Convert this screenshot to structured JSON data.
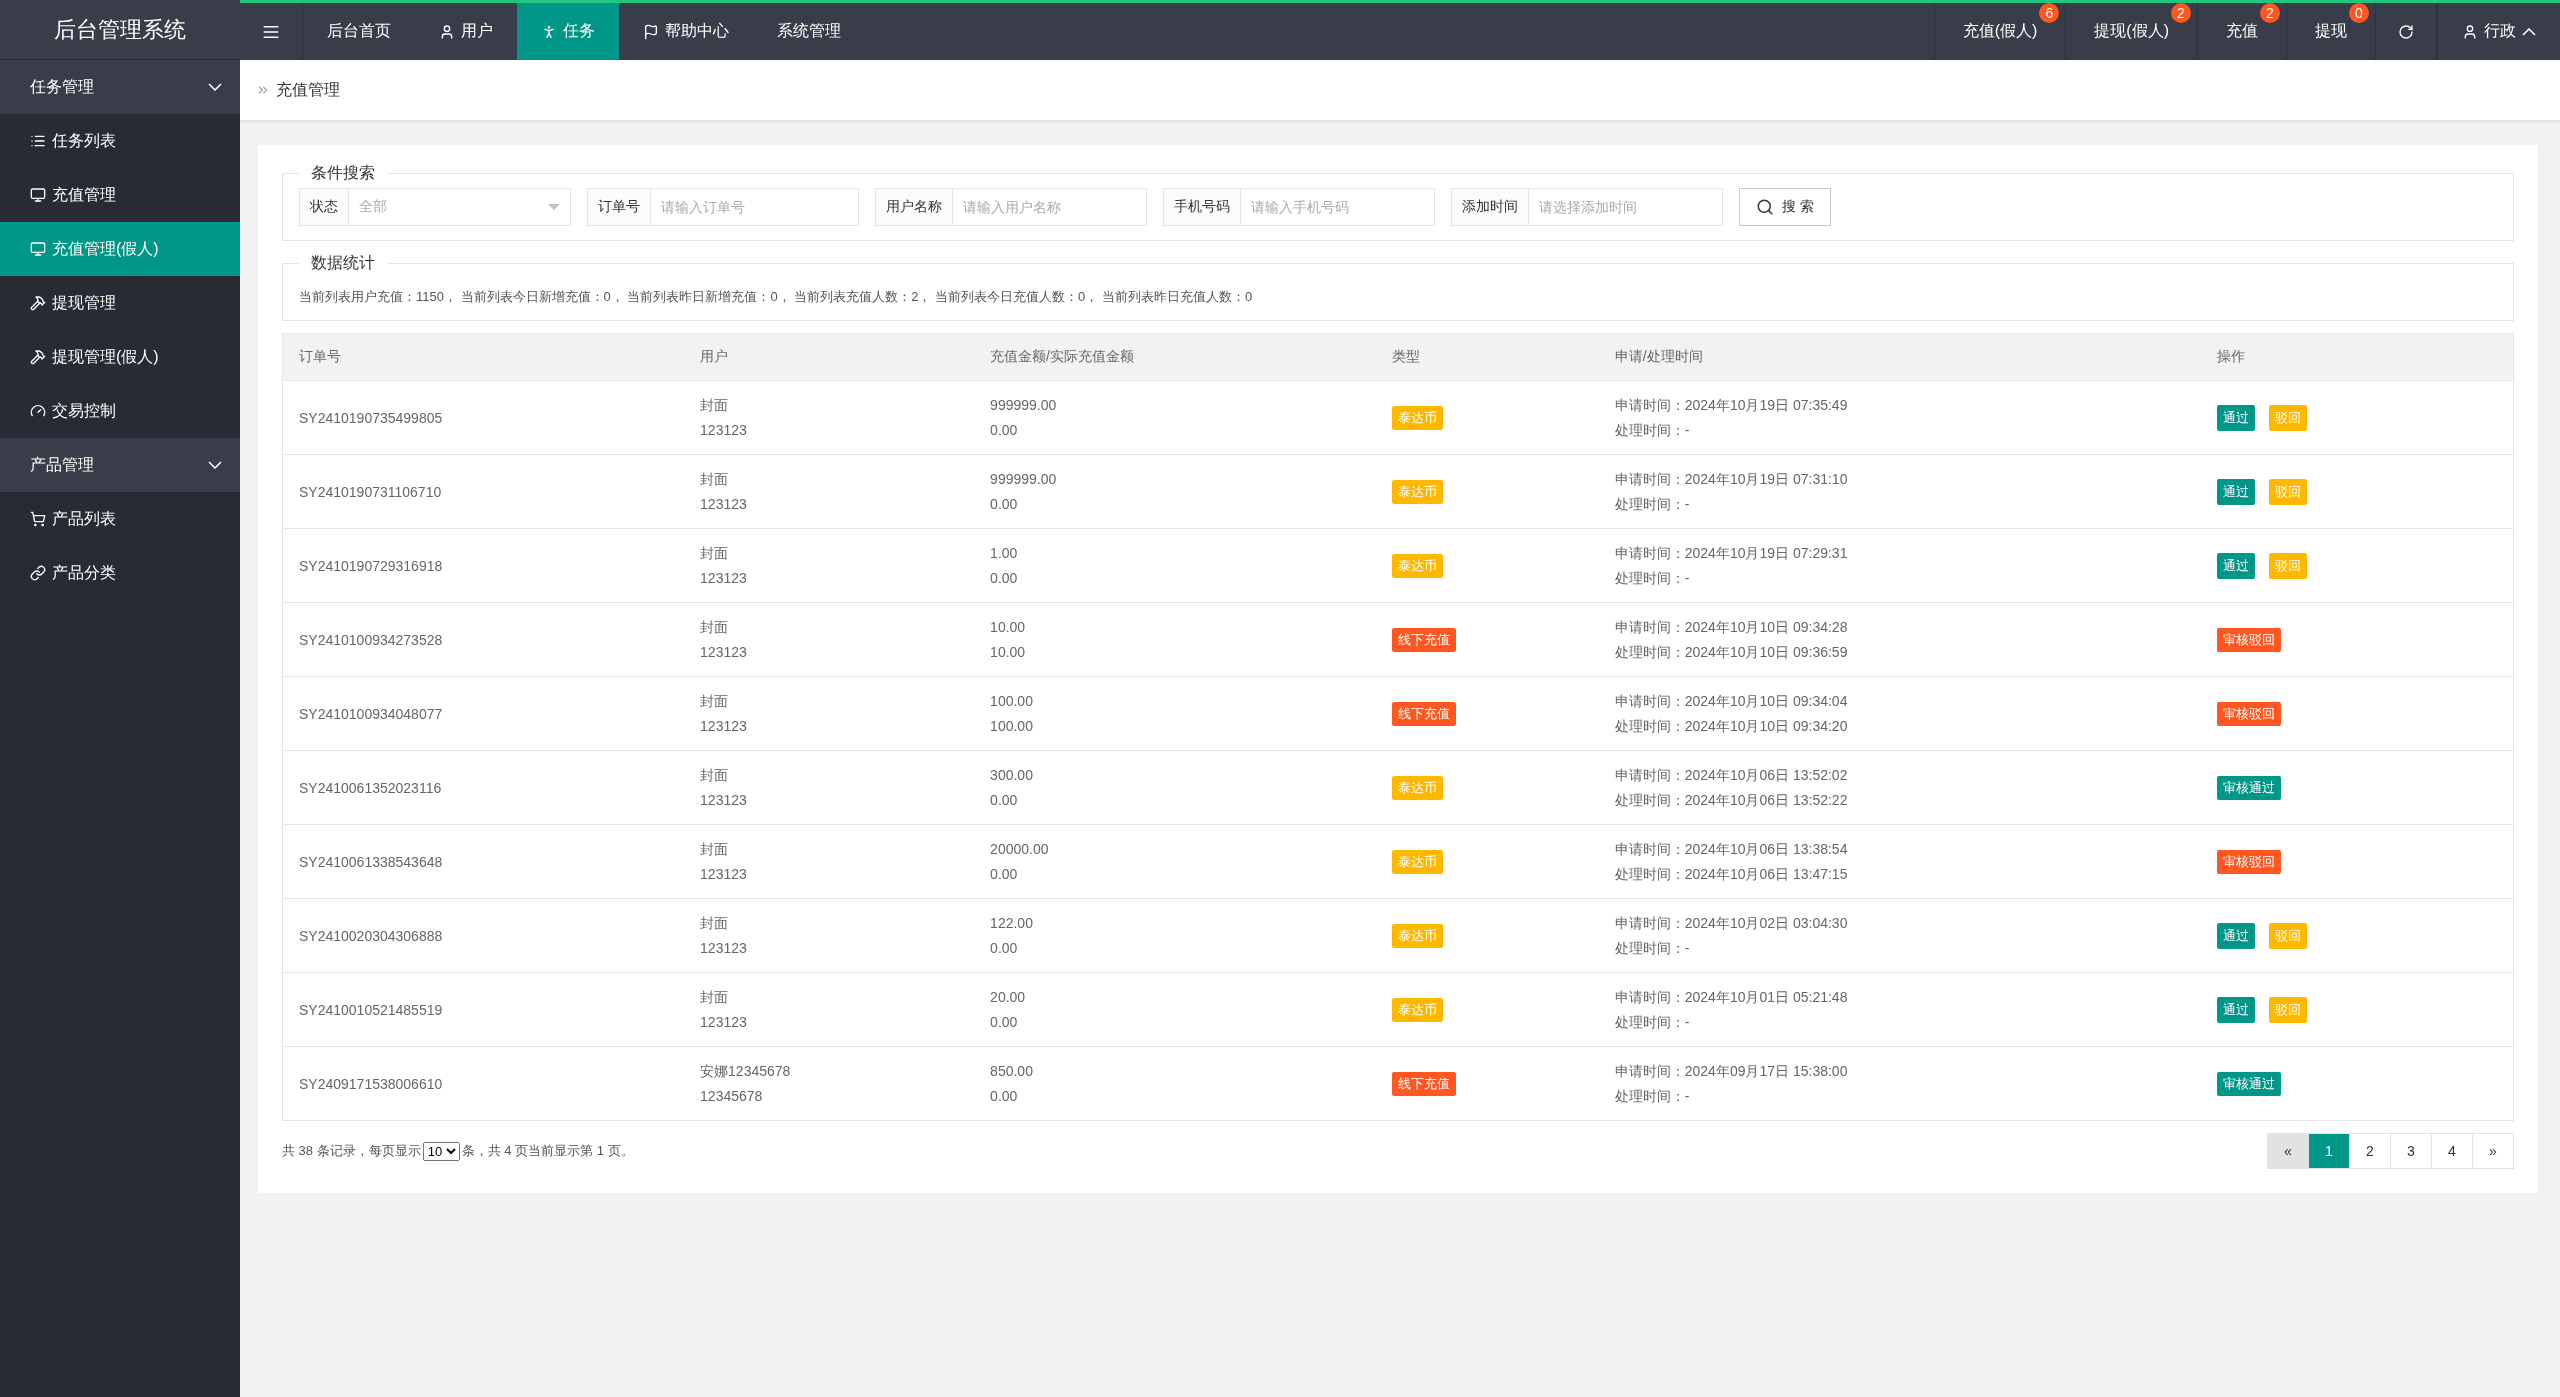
{
  "brand": "后台管理系统",
  "topnav": [
    {
      "label": "后台首页",
      "selected": false
    },
    {
      "label": "用户",
      "selected": false
    },
    {
      "label": "任务",
      "selected": true
    },
    {
      "label": "帮助中心",
      "selected": false
    },
    {
      "label": "系统管理",
      "selected": false
    }
  ],
  "counters": [
    {
      "label": "充值(假人)",
      "count": "6"
    },
    {
      "label": "提现(假人)",
      "count": "2"
    },
    {
      "label": "充值",
      "count": "2"
    },
    {
      "label": "提现",
      "count": "0"
    }
  ],
  "account": {
    "name": "行政",
    "expanded": true
  },
  "sidebar": [
    {
      "label": "任务管理",
      "expanded": true,
      "children": [
        {
          "label": "任务列表",
          "selected": false
        },
        {
          "label": "充值管理",
          "selected": false
        },
        {
          "label": "充值管理(假人)",
          "selected": true
        },
        {
          "label": "提现管理",
          "selected": false
        },
        {
          "label": "提现管理(假人)",
          "selected": false
        },
        {
          "label": "交易控制",
          "selected": false
        }
      ]
    },
    {
      "label": "产品管理",
      "expanded": true,
      "children": [
        {
          "label": "产品列表",
          "selected": false
        },
        {
          "label": "产品分类",
          "selected": false
        }
      ]
    }
  ],
  "breadcrumb": "充值管理",
  "search": {
    "legend": "条件搜索",
    "fields": [
      {
        "kind": "select",
        "label": "状态",
        "value": "全部"
      },
      {
        "kind": "text",
        "label": "订单号",
        "placeholder": "请输入订单号"
      },
      {
        "kind": "text",
        "label": "用户名称",
        "placeholder": "请输入用户名称"
      },
      {
        "kind": "text",
        "label": "手机号码",
        "placeholder": "请输入手机号码"
      },
      {
        "kind": "text",
        "label": "添加时间",
        "placeholder": "请选择添加时间"
      }
    ],
    "button": "搜 索"
  },
  "stats": {
    "legend": "数据统计",
    "text": "当前列表用户充值：1150， 当前列表今日新增充值：0， 当前列表昨日新增充值：0， 当前列表充值人数：2， 当前列表今日充值人数：0， 当前列表昨日充值人数：0"
  },
  "table": {
    "columns": [
      "订单号",
      "用户",
      "充值金额/实际充值金额",
      "类型",
      "申请/处理时间",
      "操作"
    ],
    "rows": [
      {
        "order": "SY2410190735499805",
        "user": [
          "封面",
          "123123"
        ],
        "amount": [
          "999999.00",
          "0.00"
        ],
        "type": {
          "label": "泰达币",
          "kind": "coin"
        },
        "time": [
          "申请时间：2024年10月19日 07:35:49",
          "处理时间：-"
        ],
        "actions": [
          {
            "label": "通过",
            "kind": "approve"
          },
          {
            "label": "驳回",
            "kind": "reject"
          }
        ]
      },
      {
        "order": "SY2410190731106710",
        "user": [
          "封面",
          "123123"
        ],
        "amount": [
          "999999.00",
          "0.00"
        ],
        "type": {
          "label": "泰达币",
          "kind": "coin"
        },
        "time": [
          "申请时间：2024年10月19日 07:31:10",
          "处理时间：-"
        ],
        "actions": [
          {
            "label": "通过",
            "kind": "approve"
          },
          {
            "label": "驳回",
            "kind": "reject"
          }
        ]
      },
      {
        "order": "SY2410190729316918",
        "user": [
          "封面",
          "123123"
        ],
        "amount": [
          "1.00",
          "0.00"
        ],
        "type": {
          "label": "泰达币",
          "kind": "coin"
        },
        "time": [
          "申请时间：2024年10月19日 07:29:31",
          "处理时间：-"
        ],
        "actions": [
          {
            "label": "通过",
            "kind": "approve"
          },
          {
            "label": "驳回",
            "kind": "reject"
          }
        ]
      },
      {
        "order": "SY2410100934273528",
        "user": [
          "封面",
          "123123"
        ],
        "amount": [
          "10.00",
          "10.00"
        ],
        "type": {
          "label": "线下充值",
          "kind": "offline"
        },
        "time": [
          "申请时间：2024年10月10日 09:34:28",
          "处理时间：2024年10月10日 09:36:59"
        ],
        "actions": [
          {
            "label": "审核驳回",
            "kind": "rejected"
          }
        ]
      },
      {
        "order": "SY2410100934048077",
        "user": [
          "封面",
          "123123"
        ],
        "amount": [
          "100.00",
          "100.00"
        ],
        "type": {
          "label": "线下充值",
          "kind": "offline"
        },
        "time": [
          "申请时间：2024年10月10日 09:34:04",
          "处理时间：2024年10月10日 09:34:20"
        ],
        "actions": [
          {
            "label": "审核驳回",
            "kind": "rejected"
          }
        ]
      },
      {
        "order": "SY2410061352023116",
        "user": [
          "封面",
          "123123"
        ],
        "amount": [
          "300.00",
          "0.00"
        ],
        "type": {
          "label": "泰达币",
          "kind": "coin"
        },
        "time": [
          "申请时间：2024年10月06日 13:52:02",
          "处理时间：2024年10月06日 13:52:22"
        ],
        "actions": [
          {
            "label": "审核通过",
            "kind": "approved"
          }
        ]
      },
      {
        "order": "SY2410061338543648",
        "user": [
          "封面",
          "123123"
        ],
        "amount": [
          "20000.00",
          "0.00"
        ],
        "type": {
          "label": "泰达币",
          "kind": "coin"
        },
        "time": [
          "申请时间：2024年10月06日 13:38:54",
          "处理时间：2024年10月06日 13:47:15"
        ],
        "actions": [
          {
            "label": "审核驳回",
            "kind": "rejected"
          }
        ]
      },
      {
        "order": "SY2410020304306888",
        "user": [
          "封面",
          "123123"
        ],
        "amount": [
          "122.00",
          "0.00"
        ],
        "type": {
          "label": "泰达币",
          "kind": "coin"
        },
        "time": [
          "申请时间：2024年10月02日 03:04:30",
          "处理时间：-"
        ],
        "actions": [
          {
            "label": "通过",
            "kind": "approve"
          },
          {
            "label": "驳回",
            "kind": "reject"
          }
        ]
      },
      {
        "order": "SY2410010521485519",
        "user": [
          "封面",
          "123123"
        ],
        "amount": [
          "20.00",
          "0.00"
        ],
        "type": {
          "label": "泰达币",
          "kind": "coin"
        },
        "time": [
          "申请时间：2024年10月01日 05:21:48",
          "处理时间：-"
        ],
        "actions": [
          {
            "label": "通过",
            "kind": "approve"
          },
          {
            "label": "驳回",
            "kind": "reject"
          }
        ]
      },
      {
        "order": "SY2409171538006610",
        "user": [
          "安娜12345678",
          "12345678"
        ],
        "amount": [
          "850.00",
          "0.00"
        ],
        "type": {
          "label": "线下充值",
          "kind": "offline"
        },
        "time": [
          "申请时间：2024年09月17日 15:38:00",
          "处理时间：-"
        ],
        "actions": [
          {
            "label": "审核通过",
            "kind": "approved"
          }
        ]
      }
    ]
  },
  "footer": {
    "before": "共 38 条记录，每页显示",
    "per_page": "10",
    "after": "条，共 4 页当前显示第 1 页。"
  },
  "pagination": [
    {
      "label": "«",
      "selected": false,
      "disabled": true
    },
    {
      "label": "1",
      "selected": true,
      "disabled": false
    },
    {
      "label": "2",
      "selected": false,
      "disabled": false
    },
    {
      "label": "3",
      "selected": false,
      "disabled": false
    },
    {
      "label": "4",
      "selected": false,
      "disabled": false
    },
    {
      "label": "»",
      "selected": false,
      "disabled": false
    }
  ]
}
